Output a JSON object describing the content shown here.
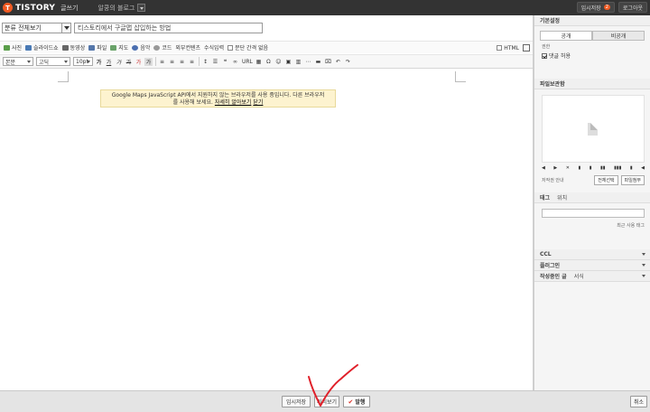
{
  "topbar": {
    "logo_mark": "T",
    "logo_text": "TISTORY",
    "logo_sub": "글쓰기",
    "blog_name": "알쿵의 블로그",
    "draft_label": "임시저장",
    "draft_count": "2",
    "logout_label": "로그아웃"
  },
  "post": {
    "category": "분류 전체보기",
    "title": "티스토리에서 구글맵 삽입하는 방법"
  },
  "toolbar1": {
    "items": [
      "사진",
      "슬라이드쇼",
      "동영상",
      "파일",
      "지도",
      "음악",
      "코드",
      "외부컨텐츠",
      "수식입력"
    ],
    "paragraph_check": "문단 간격 없음",
    "html_label": "HTML"
  },
  "toolbar2": {
    "style": "본문",
    "font": "고딕",
    "size": "10pt",
    "url_label": "URL"
  },
  "notice": {
    "line1": "Google Maps JavaScript API에서 지원하지 않는 브라우저를 사용 중입니다. 다른 브라우저",
    "line2": "를 사용해 보세요.",
    "link_more": "자세히 알아보기",
    "link_close": "닫기"
  },
  "sidebar": {
    "basic_settings": "기본설정",
    "public": "공개",
    "private": "비공개",
    "permission": "권한",
    "allow_comments": "댓글 허용",
    "attachments": "파일보관함",
    "file_tools": [
      "◀",
      "▶",
      "✕",
      "▮",
      "▮",
      "▮▮",
      "▮▮▮",
      "▮",
      "◀"
    ],
    "file_info": "저작권 안내",
    "select_all": "전체선택",
    "attach_file": "파일첨부",
    "tag_tab": "태그",
    "location_tab": "위치",
    "recent_tags": "최근 사용 태그",
    "ccl": "CCL",
    "plugins": "플러그인",
    "written_posts": "작성중인 글",
    "template": "서식"
  },
  "bottom": {
    "save_draft": "임시저장",
    "preview": "미리보기",
    "publish": "발행",
    "cancel": "취소"
  },
  "colors": {
    "accent": "#f15a22",
    "topbar": "#333333",
    "annotation": "#e0202a"
  }
}
